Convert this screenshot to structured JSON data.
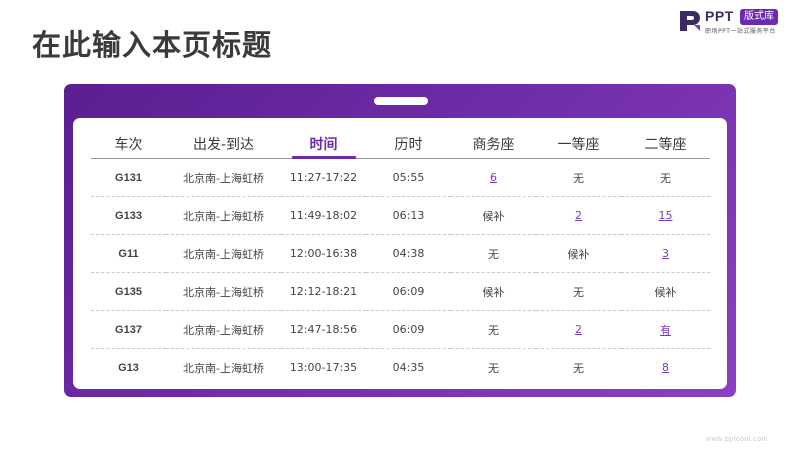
{
  "page": {
    "title": "在此输入本页标题"
  },
  "brand": {
    "name": "PPT",
    "badge": "版式库",
    "tagline": "职场PPT一站式服务平台"
  },
  "table": {
    "headers": [
      "车次",
      "出发-到达",
      "时间",
      "历时",
      "商务座",
      "一等座",
      "二等座"
    ],
    "active_header": "时间",
    "rows": [
      {
        "train": "G131",
        "route": "北京南-上海虹桥",
        "time": "11:27-17:22",
        "duration": "05:55",
        "business": "6",
        "first": "无",
        "second": "无"
      },
      {
        "train": "G133",
        "route": "北京南-上海虹桥",
        "time": "11:49-18:02",
        "duration": "06:13",
        "business": "候补",
        "first": "2",
        "second": "15"
      },
      {
        "train": "G11",
        "route": "北京南-上海虹桥",
        "time": "12:00-16:38",
        "duration": "04:38",
        "business": "无",
        "first": "候补",
        "second": "3"
      },
      {
        "train": "G135",
        "route": "北京南-上海虹桥",
        "time": "12:12-18:21",
        "duration": "06:09",
        "business": "候补",
        "first": "无",
        "second": "候补"
      },
      {
        "train": "G137",
        "route": "北京南-上海虹桥",
        "time": "12:47-18:56",
        "duration": "06:09",
        "business": "无",
        "first": "2",
        "second": "有"
      },
      {
        "train": "G13",
        "route": "北京南-上海虹桥",
        "time": "13:00-17:35",
        "duration": "04:35",
        "business": "无",
        "first": "无",
        "second": "8"
      }
    ]
  },
  "footer": {
    "url": "www.pptcool.com"
  },
  "colors": {
    "accent": "#6b2bb0",
    "time_text": "#9a4fd0",
    "frame_start": "#5b1e8f",
    "frame_end": "#8a40c2"
  }
}
